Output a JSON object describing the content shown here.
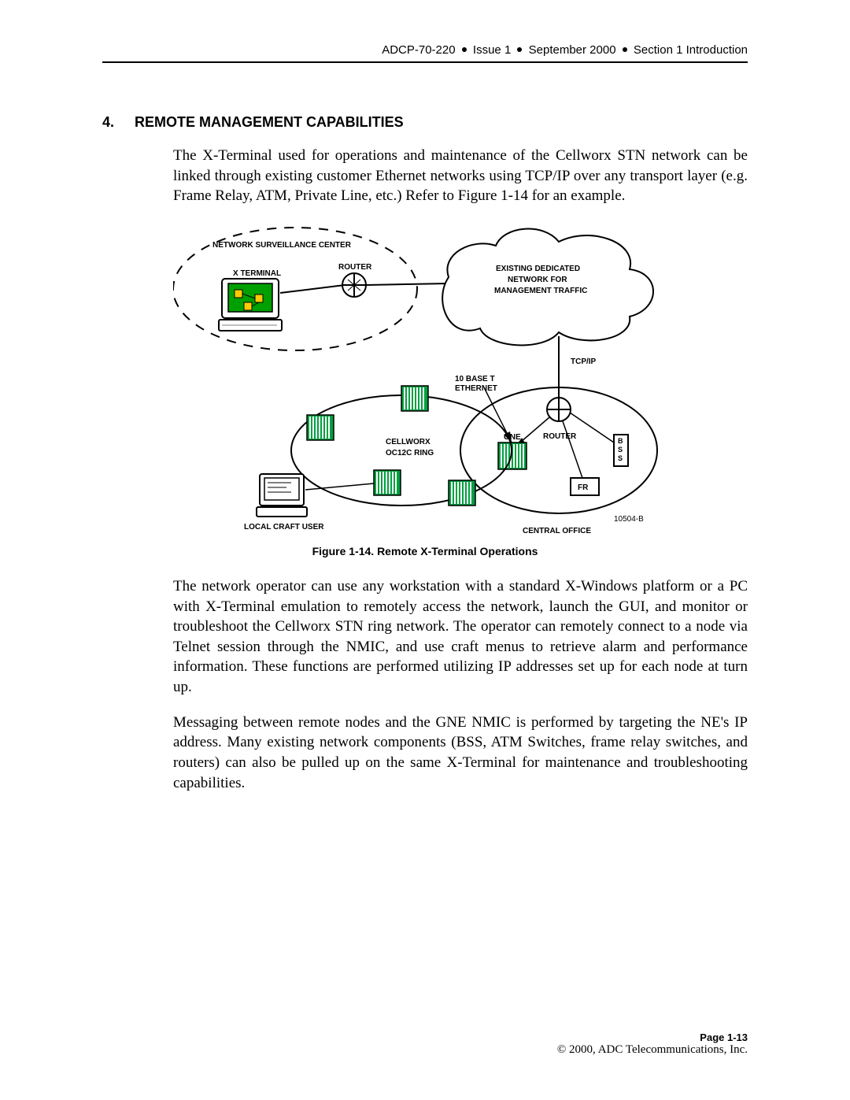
{
  "header": {
    "doc_id": "ADCP-70-220",
    "issue": "Issue 1",
    "date": "September 2000",
    "section": "Section 1 Introduction"
  },
  "section": {
    "number": "4.",
    "title": "REMOTE MANAGEMENT CAPABILITIES"
  },
  "paragraphs": {
    "p1": "The X-Terminal used for operations and maintenance of the Cellworx STN network can be linked through existing customer Ethernet networks using TCP/IP over any transport layer (e.g. Frame Relay, ATM, Private Line, etc.) Refer to Figure 1-14 for an example.",
    "p2": "The network operator can use any workstation with a standard X-Windows platform or a PC with X-Terminal emulation to remotely access the network, launch the GUI, and monitor or troubleshoot the Cellworx STN ring network. The operator can remotely connect to a node via Telnet session through the NMIC, and use craft menus to retrieve alarm and performance information. These functions are performed utilizing IP addresses set up for each node at turn up.",
    "p3": "Messaging between remote nodes and the GNE NMIC is performed by targeting the NE's IP address. Many existing network components (BSS, ATM Switches, frame relay switches, and routers) can also be pulled up on the same X-Terminal for maintenance and troubleshooting capabilities."
  },
  "figure": {
    "caption": "Figure 1-14. Remote X-Terminal Operations",
    "labels": {
      "nsc": "NETWORK SURVEILLANCE CENTER",
      "xterm": "X TERMINAL",
      "router1": "ROUTER",
      "existing_net_l1": "EXISTING DEDICATED",
      "existing_net_l2": "NETWORK FOR",
      "existing_net_l3": "MANAGEMENT TRAFFIC",
      "tcpip": "TCP/IP",
      "tenbase_l1": "10 BASE T",
      "tenbase_l2": "ETHERNET",
      "cellworx_l1": "CELLWORX",
      "cellworx_l2": "OC12C RING",
      "gne": "GNE",
      "router2": "ROUTER",
      "bss": "BSS",
      "fr": "FR",
      "local_craft": "LOCAL CRAFT USER",
      "central_office": "CENTRAL OFFICE",
      "img_id": "10504-B"
    }
  },
  "footer": {
    "page": "Page 1-13",
    "copyright": "© 2000, ADC Telecommunications, Inc."
  }
}
